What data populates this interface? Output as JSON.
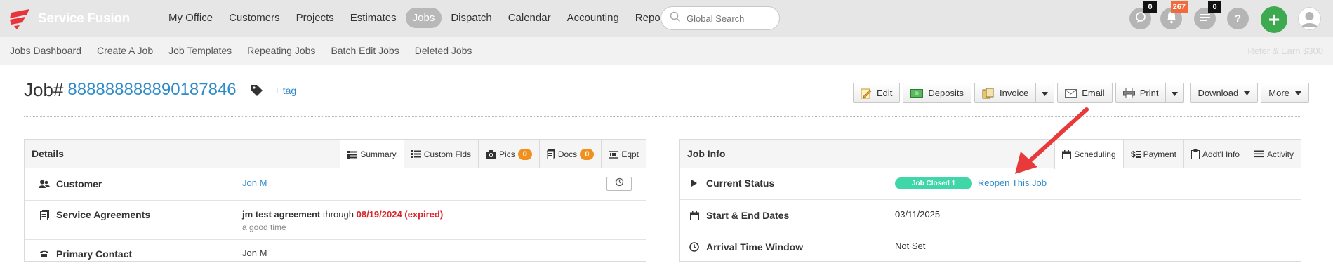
{
  "brand": {
    "name": "Service Fusion",
    "logo_color": "#e8343b"
  },
  "topnav": {
    "items": [
      {
        "label": "My Office"
      },
      {
        "label": "Customers"
      },
      {
        "label": "Projects"
      },
      {
        "label": "Estimates"
      },
      {
        "label": "Jobs",
        "active": true
      },
      {
        "label": "Dispatch"
      },
      {
        "label": "Calendar"
      },
      {
        "label": "Accounting"
      },
      {
        "label": "Reports"
      }
    ],
    "search_placeholder": "Global Search",
    "icons": [
      {
        "name": "chat-icon",
        "badge": "0"
      },
      {
        "name": "bell-icon",
        "badge": "267"
      },
      {
        "name": "list-icon",
        "badge": "0"
      },
      {
        "name": "help-icon",
        "badge": ""
      }
    ],
    "help_glyph": "?",
    "add_glyph": "+"
  },
  "subnav": {
    "items": [
      "Jobs Dashboard",
      "Create A Job",
      "Job Templates",
      "Repeating Jobs",
      "Batch Edit Jobs",
      "Deleted Jobs"
    ],
    "right_text": "Refer & Earn $300"
  },
  "job": {
    "prefix": "Job#",
    "number": "888888888890187846",
    "add_tag": "+ tag"
  },
  "actions": {
    "edit": "Edit",
    "deposits": "Deposits",
    "invoice": "Invoice",
    "email": "Email",
    "print": "Print",
    "download": "Download",
    "more": "More"
  },
  "details": {
    "title": "Details",
    "tabs": [
      {
        "label": "Summary",
        "icon": "list-icon",
        "active": true
      },
      {
        "label": "Custom Flds",
        "icon": "list-icon"
      },
      {
        "label": "Pics",
        "icon": "camera-icon",
        "badge": "0"
      },
      {
        "label": "Docs",
        "icon": "docs-icon",
        "badge": "0"
      },
      {
        "label": "Eqpt",
        "icon": "equipment-icon"
      }
    ],
    "rows": {
      "customer_label": "Customer",
      "customer_value": "Jon M",
      "agreements_label": "Service Agreements",
      "agreement_name": "jm test agreement",
      "agreement_through": "through",
      "agreement_date": "08/19/2024 (expired)",
      "agreement_note": "a good time",
      "contact_label": "Primary Contact",
      "contact_value": "Jon M"
    }
  },
  "jobinfo": {
    "title": "Job Info",
    "tabs": [
      {
        "label": "Scheduling",
        "icon": "calendar-icon",
        "active": true
      },
      {
        "label": "Payment",
        "icon": "payment-icon"
      },
      {
        "label": "Addt'l Info",
        "icon": "clipboard-icon"
      },
      {
        "label": "Activity",
        "icon": "lines-icon"
      }
    ],
    "rows": {
      "status_label": "Current Status",
      "status_value": "Job Closed 1",
      "reopen": "Reopen This Job",
      "dates_label": "Start & End Dates",
      "dates_value": "03/11/2025",
      "arrival_label": "Arrival Time Window",
      "arrival_value": "Not Set"
    }
  },
  "colors": {
    "accent": "#2e8bc9",
    "status": "#3fd6a8",
    "arrow": "#e8393b",
    "badge": "#f0901e",
    "add": "#3daa4f"
  }
}
